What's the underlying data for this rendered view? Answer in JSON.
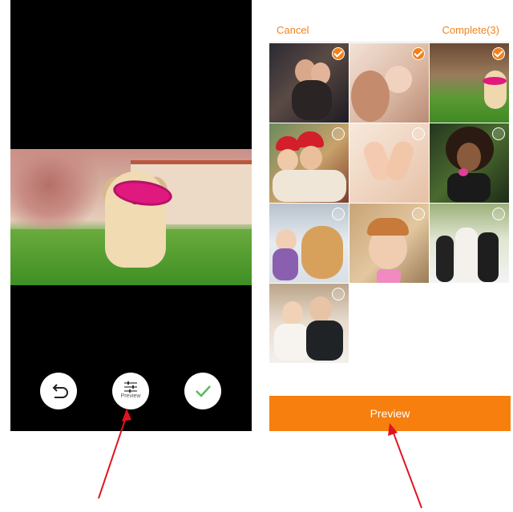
{
  "editor": {
    "controls": {
      "undo_icon": "undo-arrow-icon",
      "preview_icon": "sliders-icon",
      "preview_caption": "Preview",
      "done_icon": "checkmark-icon"
    },
    "colors": {
      "background": "#000000",
      "check_green": "#5cb85c"
    }
  },
  "picker": {
    "header": {
      "cancel_label": "Cancel",
      "complete_label": "Complete(3)"
    },
    "photos": [
      {
        "subject": "couple-night-lights",
        "selected": true
      },
      {
        "subject": "baby-with-mother",
        "selected": true
      },
      {
        "subject": "puppy-with-frisbee",
        "selected": true
      },
      {
        "subject": "christmas-couple",
        "selected": false
      },
      {
        "subject": "baby-feet-heart",
        "selected": false
      },
      {
        "subject": "woman-blowing-glitter",
        "selected": false
      },
      {
        "subject": "girl-with-golden-retriever",
        "selected": false
      },
      {
        "subject": "child-playing",
        "selected": false
      },
      {
        "subject": "wedding-party",
        "selected": false
      },
      {
        "subject": "bride-and-groom",
        "selected": false
      }
    ],
    "preview_label": "Preview",
    "colors": {
      "accent": "#f0821e",
      "preview_bar": "#f67f0e"
    }
  },
  "annotations": {
    "arrow_color": "#e0141e"
  }
}
